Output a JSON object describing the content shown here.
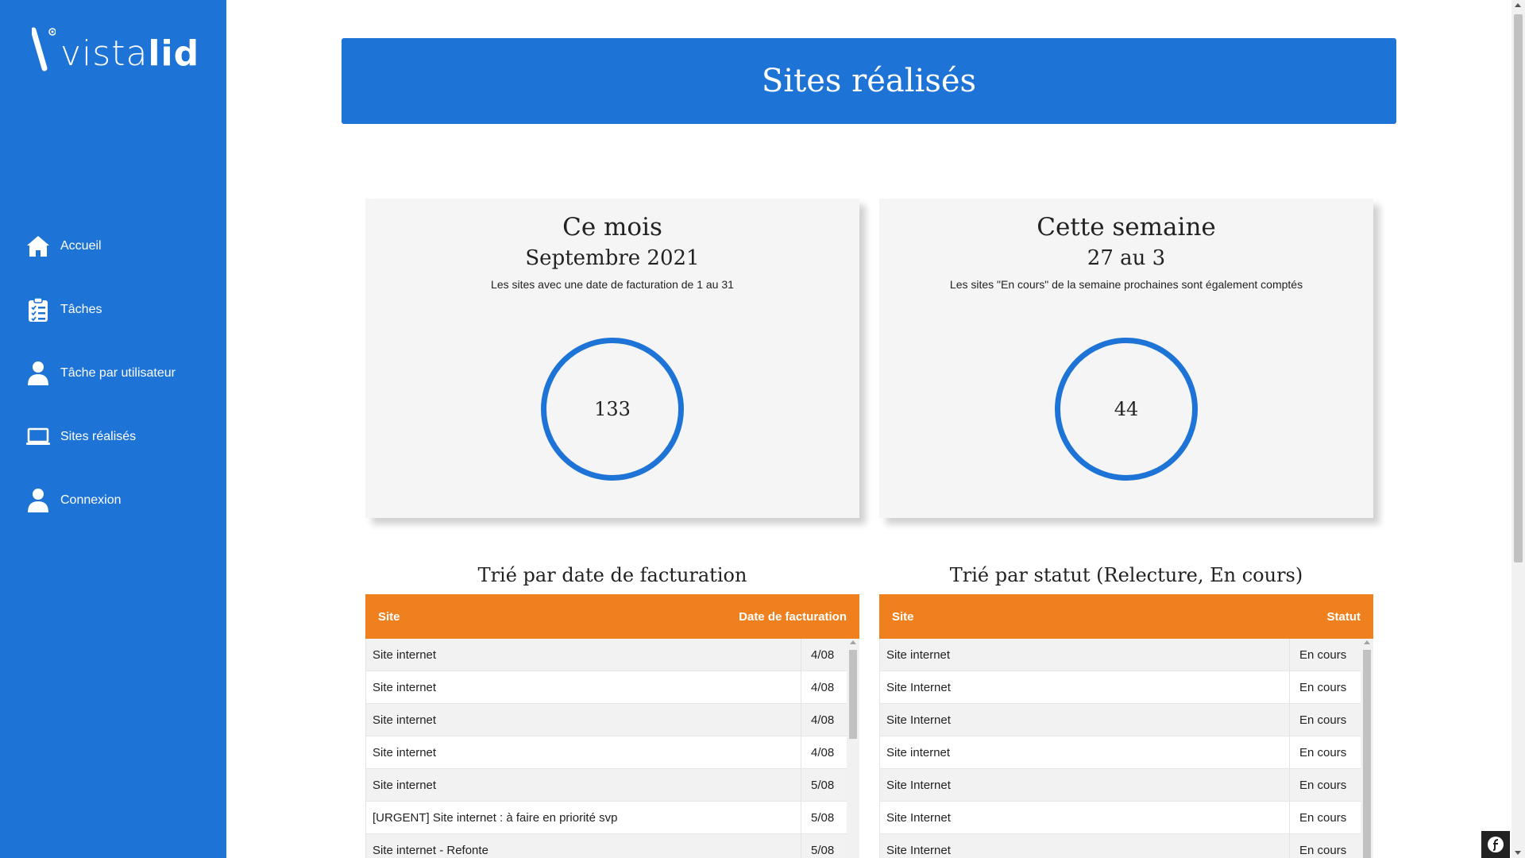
{
  "brand": {
    "logo_thin": "vista",
    "logo_bold": "lid"
  },
  "sidebar": {
    "items": [
      {
        "label": "Accueil",
        "icon": "home-icon"
      },
      {
        "label": "Tâches",
        "icon": "clipboard-list-icon"
      },
      {
        "label": "Tâche par utilisateur",
        "icon": "user-icon"
      },
      {
        "label": "Sites réalisés",
        "icon": "laptop-icon"
      },
      {
        "label": "Connexion",
        "icon": "user-icon"
      }
    ]
  },
  "header": {
    "title": "Sites réalisés"
  },
  "cards": {
    "month": {
      "title": "Ce mois",
      "subtitle": "Septembre 2021",
      "description": "Les sites avec une date de facturation de 1 au 31",
      "count": "133"
    },
    "week": {
      "title": "Cette semaine",
      "subtitle": "27 au 3",
      "description": "Les sites \"En cours\" de la semaine prochaines sont également comptés",
      "count": "44"
    }
  },
  "tables": {
    "by_date": {
      "title": "Trié par date de facturation",
      "col_site": "Site",
      "col_value": "Date de facturation",
      "rows": [
        {
          "site": "Site internet",
          "value": "4/08"
        },
        {
          "site": "Site internet",
          "value": "4/08"
        },
        {
          "site": "Site internet",
          "value": "4/08"
        },
        {
          "site": "Site internet",
          "value": "4/08"
        },
        {
          "site": "Site internet",
          "value": "5/08"
        },
        {
          "site": "[URGENT] Site internet : à faire en priorité svp",
          "value": "5/08"
        },
        {
          "site": "Site internet - Refonte",
          "value": "5/08"
        }
      ]
    },
    "by_status": {
      "title": "Trié par statut (Relecture, En cours)",
      "col_site": "Site",
      "col_value": "Statut",
      "rows": [
        {
          "site": "Site internet",
          "value": "En cours"
        },
        {
          "site": "Site Internet",
          "value": "En cours"
        },
        {
          "site": "Site Internet",
          "value": "En cours"
        },
        {
          "site": "Site internet",
          "value": "En cours"
        },
        {
          "site": "Site Internet",
          "value": "En cours"
        },
        {
          "site": "Site Internet",
          "value": "En cours"
        },
        {
          "site": "Site Internet",
          "value": "En cours"
        }
      ]
    }
  },
  "colors": {
    "primary": "#1e74d6",
    "table_header": "#f0801d",
    "card_bg": "#f5f5f5"
  }
}
